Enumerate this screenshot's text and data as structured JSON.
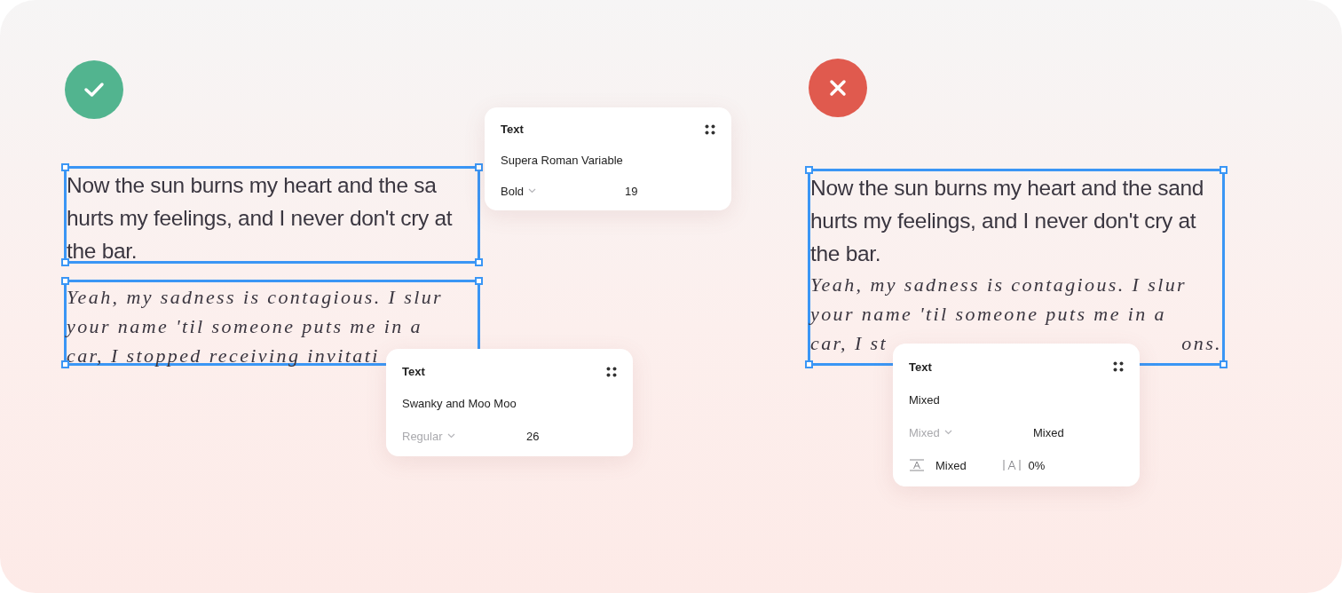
{
  "examples": [
    {
      "correct": true,
      "frames": [
        {
          "paragraphs": [
            {
              "kind": "sans",
              "lines": [
                [
                  "Now the sun burns my heart and the sa"
                ],
                [
                  "hurts my feelings, and I never don't cry at"
                ],
                [
                  "the bar."
                ]
              ]
            }
          ]
        },
        {
          "paragraphs": [
            {
              "kind": "script",
              "lines": [
                [
                  "Yeah, my sadness is contagious. I slur"
                ],
                [
                  "your name 'til someone puts me in a"
                ],
                [
                  "car, I stopped receiving invitati"
                ]
              ]
            }
          ]
        }
      ],
      "panels": [
        {
          "title": "Text",
          "font": "Supera Roman Variable",
          "weight": {
            "label": "Bold",
            "dimmed": false
          },
          "size": "19"
        },
        {
          "title": "Text",
          "font": "Swanky and Moo Moo",
          "weight": {
            "label": "Regular",
            "dimmed": true
          },
          "size": "26"
        }
      ]
    },
    {
      "correct": false,
      "frames": [
        {
          "paragraphs": [
            {
              "kind": "sans",
              "lines": [
                [
                  "Now the sun burns my heart and the sand"
                ],
                [
                  "hurts my feelings, and I never don't cry at"
                ],
                [
                  "the bar."
                ]
              ]
            },
            {
              "kind": "script",
              "lines": [
                [
                  "Yeah, my sadness is contagious. I slur"
                ],
                [
                  "your name 'til someone puts me in a"
                ],
                [
                  "car, I st",
                  "ons."
                ]
              ]
            }
          ]
        }
      ],
      "panels": [
        {
          "title": "Text",
          "font": "Mixed",
          "weight": {
            "label": "Mixed",
            "dimmed": true
          },
          "size": "Mixed",
          "spacing": {
            "line_height": "Mixed",
            "letter_spacing": "0%"
          }
        }
      ]
    }
  ]
}
